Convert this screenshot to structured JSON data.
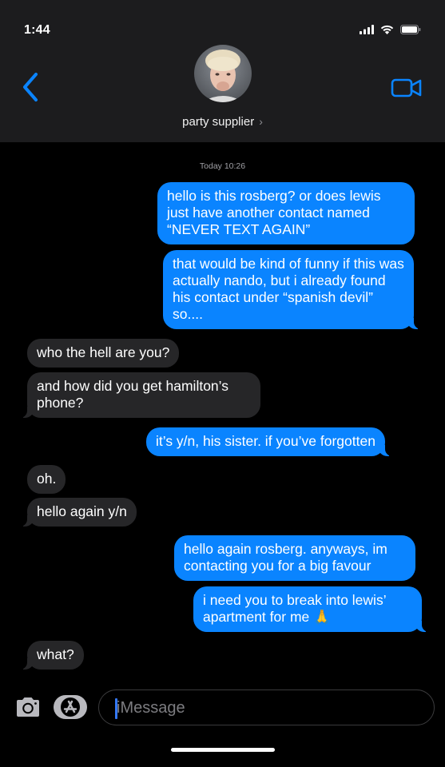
{
  "status_bar": {
    "time": "1:44"
  },
  "header": {
    "contact_name": "party supplier",
    "chevron": "›"
  },
  "conversation": {
    "timestamp": "Today 10:26",
    "messages": [
      {
        "from": "me",
        "text": "hello is this rosberg? or does lewis just have another contact named “NEVER TEXT AGAIN”"
      },
      {
        "from": "me",
        "text": "that would be kind of funny if this was actually nando, but i already found his contact under “spanish devil” so...."
      },
      {
        "from": "them",
        "text": "who the hell are you?"
      },
      {
        "from": "them",
        "text": "and how did you get hamilton’s phone?"
      },
      {
        "from": "me",
        "text": "it’s y/n, his sister. if you’ve forgotten"
      },
      {
        "from": "them",
        "text": "oh."
      },
      {
        "from": "them",
        "text": "hello again y/n"
      },
      {
        "from": "me",
        "text": "hello again rosberg. anyways, im contacting you for a big favour"
      },
      {
        "from": "me",
        "text": "i need you to break into lewis’ apartment for me 🙏"
      },
      {
        "from": "them",
        "text": "what?"
      }
    ]
  },
  "input": {
    "placeholder": "iMessage"
  },
  "icons": {
    "back": "chevron-left-icon",
    "video": "video-camera-icon",
    "camera": "camera-icon",
    "apps": "app-store-icon"
  },
  "colors": {
    "accent": "#0a84ff",
    "sent_bubble": "#0a84ff",
    "received_bubble": "#262628",
    "header_bg": "#1c1c1e"
  }
}
